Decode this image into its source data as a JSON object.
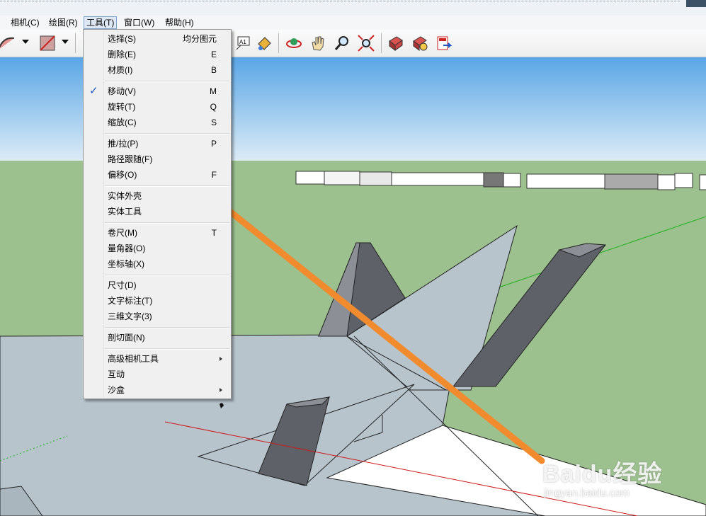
{
  "menubar": {
    "items": [
      {
        "label": "相机(C)"
      },
      {
        "label": "绘图(R)"
      },
      {
        "label": "工具(T)"
      },
      {
        "label": "窗口(W)"
      },
      {
        "label": "帮助(H)"
      }
    ]
  },
  "toolbar": {
    "icons": [
      "arc-icon",
      "rectangle-icon",
      "text-label-icon",
      "paint-bucket-icon",
      "orbit-icon",
      "pan-hand-icon",
      "zoom-icon",
      "zoom-extents-icon",
      "component-get-icon",
      "component-share-icon",
      "export-icon"
    ]
  },
  "tools_menu": {
    "items": [
      {
        "label": "选择(S)",
        "key": "均分图元"
      },
      {
        "label": "删除(E)",
        "key": "E"
      },
      {
        "label": "材质(I)",
        "key": "B"
      },
      {
        "label": "移动(V)",
        "key": "M",
        "checked": "✓"
      },
      {
        "label": "旋转(T)",
        "key": "Q"
      },
      {
        "label": "缩放(C)",
        "key": "S"
      },
      {
        "label": "推/拉(P)",
        "key": "P"
      },
      {
        "label": "路径跟随(F)",
        "key": ""
      },
      {
        "label": "偏移(O)",
        "key": "F"
      },
      {
        "label": "实体外壳",
        "key": ""
      },
      {
        "label": "实体工具",
        "key": ""
      },
      {
        "label": "卷尺(M)",
        "key": "T"
      },
      {
        "label": "量角器(O)",
        "key": ""
      },
      {
        "label": "坐标轴(X)",
        "key": ""
      },
      {
        "label": "尺寸(D)",
        "key": ""
      },
      {
        "label": "文字标注(T)",
        "key": ""
      },
      {
        "label": "三维文字(3)",
        "key": ""
      },
      {
        "label": "剖切面(N)",
        "key": ""
      },
      {
        "label": "高级相机工具",
        "key": ""
      },
      {
        "label": "互动",
        "key": ""
      },
      {
        "label": "沙盒",
        "key": ""
      }
    ]
  },
  "colors": {
    "sky_top": "#5aa6e6",
    "sky_bottom": "#dcebf6",
    "ground": "#9cc08e",
    "surface": "#b8c4cc",
    "dark_face": "#5e6268",
    "arrow": "#f28a2e",
    "accent": "#1d57c7"
  },
  "watermark": {
    "main": "Baidu经验",
    "sub": "jingyan.baidu.com"
  }
}
